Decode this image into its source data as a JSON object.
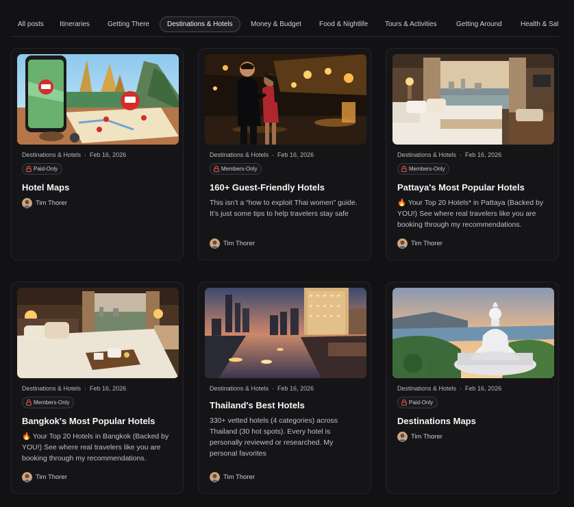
{
  "tabs": [
    {
      "label": "All posts",
      "active": false
    },
    {
      "label": "Itineraries",
      "active": false
    },
    {
      "label": "Getting There",
      "active": false
    },
    {
      "label": "Destinations & Hotels",
      "active": true
    },
    {
      "label": "Money & Budget",
      "active": false
    },
    {
      "label": "Food & Nightlife",
      "active": false
    },
    {
      "label": "Tours & Activities",
      "active": false
    },
    {
      "label": "Getting Around",
      "active": false
    },
    {
      "label": "Health & Safety",
      "active": false
    }
  ],
  "posts": [
    {
      "category": "Destinations & Hotels",
      "date": "Feb 16, 2026",
      "access": "Paid-Only",
      "title": "Hotel Maps",
      "excerpt": "",
      "author": "Tim Thorer",
      "image": "map-phone"
    },
    {
      "category": "Destinations & Hotels",
      "date": "Feb 16, 2026",
      "access": "Members-Only",
      "title": "160+ Guest-Friendly Hotels",
      "excerpt": "This isn’t a “how to exploit Thai women” guide. It’s just some tips to help travelers stay safe",
      "author": "Tim Thorer",
      "image": "couple-night"
    },
    {
      "category": "Destinations & Hotels",
      "date": "Feb 16, 2026",
      "access": "Members-Only",
      "title": "Pattaya's Most Popular Hotels",
      "excerpt": "🔥 Your Top 20 Hotels* in Pattaya (Backed by YOU!) See where real travelers like you are booking through my recommendations.",
      "author": "Tim Thorer",
      "image": "hotel-room-sea"
    },
    {
      "category": "Destinations & Hotels",
      "date": "Feb 16, 2026",
      "access": "Members-Only",
      "title": "Bangkok's Most Popular Hotels",
      "excerpt": "🔥 Your Top 20 Hotels in Bangkok (Backed by YOU!) See where real travelers like you are booking through my recommendations.",
      "author": "Tim Thorer",
      "image": "bedroom-tray"
    },
    {
      "category": "Destinations & Hotels",
      "date": "Feb 16, 2026",
      "access": "",
      "title": "Thailand's Best Hotels",
      "excerpt": "330+ vetted hotels (4 categories) across Thailand (30 hot spots). Every hotel is personally reviewed or researched. My personal favorites",
      "author": "Tim Thorer",
      "image": "bangkok-river"
    },
    {
      "category": "Destinations & Hotels",
      "date": "Feb 16, 2026",
      "access": "Paid-Only",
      "title": "Destinations Maps",
      "excerpt": "",
      "author": "Tim Thorer",
      "image": "white-buddha"
    }
  ]
}
